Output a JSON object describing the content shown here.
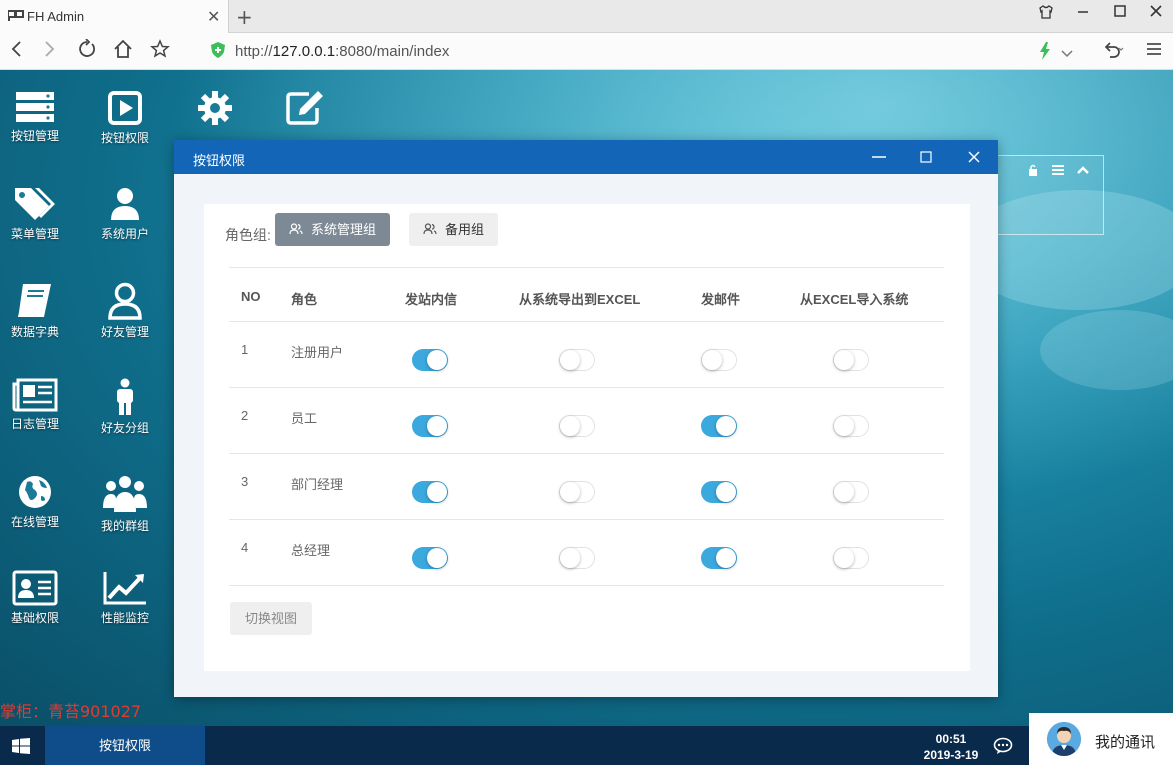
{
  "browser": {
    "tab_title": "FH Admin",
    "url_prefix": "http://",
    "url_host": "127.0.0.1",
    "url_rest": ":8080/main/index"
  },
  "desktop": {
    "icons": [
      {
        "label": "按钮管理",
        "icon": "server-icon"
      },
      {
        "label": "按钮权限",
        "icon": "play-icon"
      },
      {
        "label": "菜单管理",
        "icon": "tags-icon"
      },
      {
        "label": "系统用户",
        "icon": "user-icon"
      },
      {
        "label": "数据字典",
        "icon": "book-icon"
      },
      {
        "label": "好友管理",
        "icon": "user-outline-icon"
      },
      {
        "label": "日志管理",
        "icon": "newspaper-icon"
      },
      {
        "label": "好友分组",
        "icon": "person-icon"
      },
      {
        "label": "在线管理",
        "icon": "globe-icon"
      },
      {
        "label": "我的群组",
        "icon": "users-icon"
      },
      {
        "label": "基础权限",
        "icon": "id-card-icon"
      },
      {
        "label": "性能监控",
        "icon": "line-chart-icon"
      }
    ],
    "top_icons": [
      {
        "icon": "gear-icon"
      },
      {
        "icon": "edit-icon"
      }
    ],
    "watermark": "掌柜：青苔901027"
  },
  "modal": {
    "title": "按钮权限",
    "group_label": "角色组:",
    "groups": [
      {
        "label": "系统管理组",
        "active": true
      },
      {
        "label": "备用组",
        "active": false
      }
    ],
    "columns": [
      "NO",
      "角色",
      "发站内信",
      "从系统导出到EXCEL",
      "发邮件",
      "从EXCEL导入系统"
    ],
    "rows": [
      {
        "no": "1",
        "role": "注册用户",
        "perms": [
          true,
          false,
          false,
          false
        ]
      },
      {
        "no": "2",
        "role": "员工",
        "perms": [
          true,
          false,
          true,
          false
        ]
      },
      {
        "no": "3",
        "role": "部门经理",
        "perms": [
          true,
          false,
          true,
          false
        ]
      },
      {
        "no": "4",
        "role": "总经理",
        "perms": [
          true,
          false,
          true,
          false
        ]
      }
    ],
    "toggle_view_label": "切换视图"
  },
  "taskbar": {
    "active_task": "按钮权限",
    "time": "00:51",
    "date": "2019-3-19",
    "im_label": "我的通讯"
  },
  "colors": {
    "modal_header": "#1365b8",
    "switch_on": "#3ba8de",
    "taskbar": "#0a2a4c",
    "active_task": "#0f4d8a",
    "watermark": "#e23b2f"
  }
}
